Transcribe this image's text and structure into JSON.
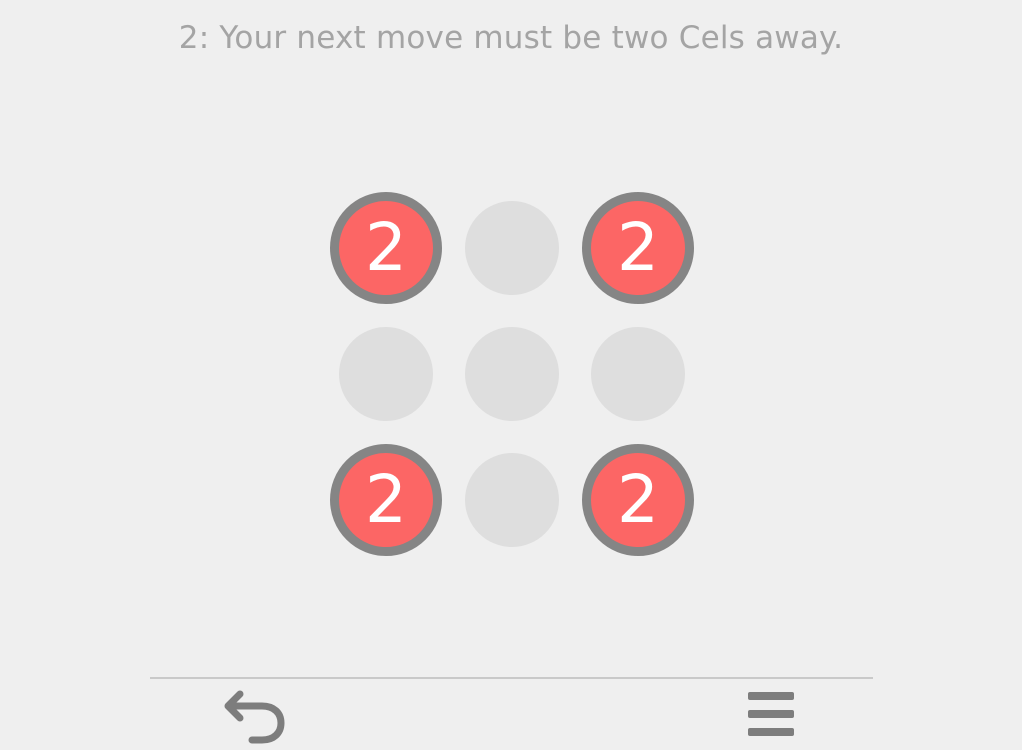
{
  "hint": {
    "text": "2: Your next move must be two Cels away."
  },
  "grid": {
    "rows": 3,
    "cols": 3,
    "cells": [
      {
        "row": 0,
        "col": 0,
        "state": "numbered",
        "label": "2"
      },
      {
        "row": 0,
        "col": 1,
        "state": "empty",
        "label": ""
      },
      {
        "row": 0,
        "col": 2,
        "state": "numbered",
        "label": "2"
      },
      {
        "row": 1,
        "col": 0,
        "state": "empty",
        "label": ""
      },
      {
        "row": 1,
        "col": 1,
        "state": "empty",
        "label": ""
      },
      {
        "row": 1,
        "col": 2,
        "state": "empty",
        "label": ""
      },
      {
        "row": 2,
        "col": 0,
        "state": "numbered",
        "label": "2"
      },
      {
        "row": 2,
        "col": 1,
        "state": "empty",
        "label": ""
      },
      {
        "row": 2,
        "col": 2,
        "state": "numbered",
        "label": "2"
      }
    ]
  },
  "toolbar": {
    "undo_icon": "undo-arrow-icon",
    "menu_icon": "hamburger-menu-icon"
  },
  "colors": {
    "background": "#efefef",
    "numbered_fill": "#fc6665",
    "numbered_ring": "#858585",
    "empty_fill": "#dedede",
    "hint_text": "#a4a4a4",
    "icon": "#7d7d7d"
  }
}
